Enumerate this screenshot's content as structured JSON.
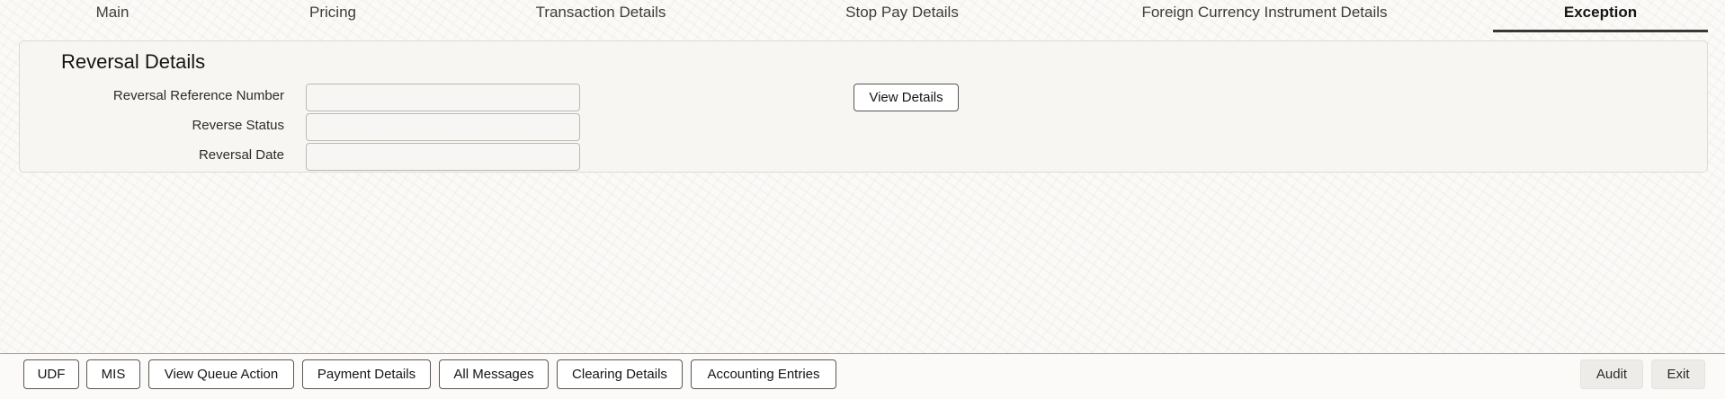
{
  "tabs": [
    {
      "label": "Main",
      "active": false
    },
    {
      "label": "Pricing",
      "active": false
    },
    {
      "label": "Transaction Details",
      "active": false
    },
    {
      "label": "Stop Pay Details",
      "active": false
    },
    {
      "label": "Foreign Currency Instrument Details",
      "active": false
    },
    {
      "label": "Exception",
      "active": true
    }
  ],
  "section": {
    "title": "Reversal Details",
    "fields": [
      {
        "label": "Reversal Reference Number",
        "value": ""
      },
      {
        "label": "Reverse Status",
        "value": ""
      },
      {
        "label": "Reversal Date",
        "value": ""
      }
    ],
    "view_details_label": "View Details"
  },
  "footer": {
    "buttons": [
      "UDF",
      "MIS",
      "View Queue Action",
      "Payment Details",
      "All Messages",
      "Clearing Details",
      "Accounting Entries"
    ],
    "audit_label": "Audit",
    "exit_label": "Exit"
  }
}
